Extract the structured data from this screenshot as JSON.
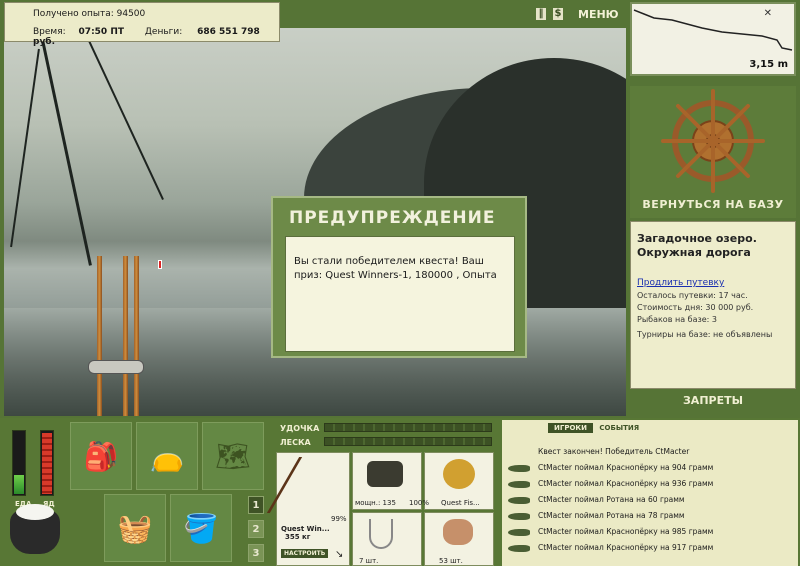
{
  "status": {
    "exp_label": "Получено опыта:",
    "exp_value": "94500",
    "time_label": "Время:",
    "time_value": "07:50 ПТ",
    "money_label": "Деньги:",
    "money_value": "686 551 798 руб."
  },
  "topbar": {
    "pause_icon": "pause-icon",
    "dollar_icon": "$",
    "menu_label": "МЕНЮ"
  },
  "minimap": {
    "depth": "3,15 m",
    "close_symbol": "✕"
  },
  "right_panel": {
    "return_label": "ВЕРНУТЬСЯ НА БАЗУ",
    "location_title": "Загадочное озеро. Окружная дорога",
    "extend_link": "Продлить путевку",
    "permit_left": "Осталось путевки: 17 час.",
    "day_cost": "Стоимость дня: 30 000 руб.",
    "anglers": "Рыбаков на базе: 3",
    "tournaments": "Турниры на базе: не объявлены",
    "bans_label": "ЗАПРЕТЫ"
  },
  "dialog": {
    "title": "ПРЕДУПРЕЖДЕНИЕ",
    "message": "Вы стали победителем квеста! Ваш приз: Quest Winners-1, 180000 , Опыта"
  },
  "meters": {
    "food_label": "ЕДА",
    "poison_label": "ЯД",
    "food_level": 0.3,
    "poison_level": 0.95
  },
  "slots": {
    "numbers": [
      "1",
      "2",
      "3"
    ]
  },
  "gear": {
    "rod_label": "УДОЧКА",
    "line_label": "ЛЕСКА",
    "rod_name": "Quest Win...",
    "rod_weight": "355 кг",
    "rod_percent": "99%",
    "setup_button": "НАСТРОИТЬ",
    "reel_power": "мощн.: 135",
    "reel_percent": "100%",
    "lure_name": "Quest Fis...",
    "hook_count": "7 шт.",
    "bait_count": "53 шт."
  },
  "events": {
    "tab_players": "ИГРОКИ",
    "tab_events": "СОБЫТИЯ",
    "items": [
      "Квест закончен! Победитель CtMacter",
      "CtMacter поймал Краснопёрку на 904 грамм",
      "CtMacter поймал Краснопёрку на 936 грамм",
      "CtMacter поймал Ротана на 60 грамм",
      "CtMacter поймал Ротана на 78 грамм",
      "CtMacter поймал Краснопёрку на 985 грамм",
      "CtMacter поймал Краснопёрку на 917 грамм"
    ]
  }
}
